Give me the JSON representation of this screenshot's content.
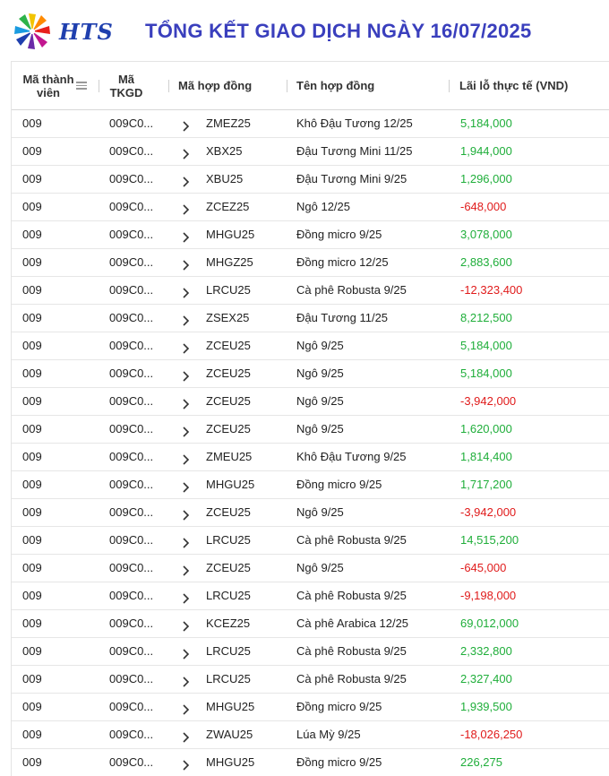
{
  "header": {
    "logo_text": "HTS",
    "title": "TỔNG KẾT GIAO DỊCH NGÀY 16/07/2025"
  },
  "columns": {
    "member_line1": "Mã thành",
    "member_line2": "viên",
    "account_line1": "Mã",
    "account_line2": "TKGD",
    "contract_code": "Mã hợp đồng",
    "contract_name": "Tên hợp đồng",
    "pnl": "Lãi lỗ thực tế (VND)"
  },
  "colors": {
    "positive": "#1fae3a",
    "negative": "#e01b1b",
    "title": "#3a3fbd"
  },
  "rows": [
    {
      "member": "009",
      "account": "009C0...",
      "code": "ZMEZ25",
      "name": "Khô Đậu Tương 12/25",
      "pnl": "5,184,000",
      "sign": "pos"
    },
    {
      "member": "009",
      "account": "009C0...",
      "code": "XBX25",
      "name": "Đậu Tương Mini 11/25",
      "pnl": "1,944,000",
      "sign": "pos"
    },
    {
      "member": "009",
      "account": "009C0...",
      "code": "XBU25",
      "name": "Đậu Tương Mini 9/25",
      "pnl": "1,296,000",
      "sign": "pos"
    },
    {
      "member": "009",
      "account": "009C0...",
      "code": "ZCEZ25",
      "name": "Ngô 12/25",
      "pnl": "-648,000",
      "sign": "neg"
    },
    {
      "member": "009",
      "account": "009C0...",
      "code": "MHGU25",
      "name": "Đồng micro 9/25",
      "pnl": "3,078,000",
      "sign": "pos"
    },
    {
      "member": "009",
      "account": "009C0...",
      "code": "MHGZ25",
      "name": "Đồng micro 12/25",
      "pnl": "2,883,600",
      "sign": "pos"
    },
    {
      "member": "009",
      "account": "009C0...",
      "code": "LRCU25",
      "name": "Cà phê Robusta 9/25",
      "pnl": "-12,323,400",
      "sign": "neg"
    },
    {
      "member": "009",
      "account": "009C0...",
      "code": "ZSEX25",
      "name": "Đậu Tương 11/25",
      "pnl": "8,212,500",
      "sign": "pos"
    },
    {
      "member": "009",
      "account": "009C0...",
      "code": "ZCEU25",
      "name": "Ngô 9/25",
      "pnl": "5,184,000",
      "sign": "pos"
    },
    {
      "member": "009",
      "account": "009C0...",
      "code": "ZCEU25",
      "name": "Ngô 9/25",
      "pnl": "5,184,000",
      "sign": "pos"
    },
    {
      "member": "009",
      "account": "009C0...",
      "code": "ZCEU25",
      "name": "Ngô 9/25",
      "pnl": "-3,942,000",
      "sign": "neg"
    },
    {
      "member": "009",
      "account": "009C0...",
      "code": "ZCEU25",
      "name": "Ngô 9/25",
      "pnl": "1,620,000",
      "sign": "pos"
    },
    {
      "member": "009",
      "account": "009C0...",
      "code": "ZMEU25",
      "name": "Khô Đậu Tương 9/25",
      "pnl": "1,814,400",
      "sign": "pos"
    },
    {
      "member": "009",
      "account": "009C0...",
      "code": "MHGU25",
      "name": "Đồng micro 9/25",
      "pnl": "1,717,200",
      "sign": "pos"
    },
    {
      "member": "009",
      "account": "009C0...",
      "code": "ZCEU25",
      "name": "Ngô 9/25",
      "pnl": "-3,942,000",
      "sign": "neg"
    },
    {
      "member": "009",
      "account": "009C0...",
      "code": "LRCU25",
      "name": "Cà phê Robusta 9/25",
      "pnl": "14,515,200",
      "sign": "pos"
    },
    {
      "member": "009",
      "account": "009C0...",
      "code": "ZCEU25",
      "name": "Ngô 9/25",
      "pnl": "-645,000",
      "sign": "neg"
    },
    {
      "member": "009",
      "account": "009C0...",
      "code": "LRCU25",
      "name": "Cà phê Robusta 9/25",
      "pnl": "-9,198,000",
      "sign": "neg"
    },
    {
      "member": "009",
      "account": "009C0...",
      "code": "KCEZ25",
      "name": "Cà phê Arabica 12/25",
      "pnl": "69,012,000",
      "sign": "pos"
    },
    {
      "member": "009",
      "account": "009C0...",
      "code": "LRCU25",
      "name": "Cà phê Robusta 9/25",
      "pnl": "2,332,800",
      "sign": "pos"
    },
    {
      "member": "009",
      "account": "009C0...",
      "code": "LRCU25",
      "name": "Cà phê Robusta 9/25",
      "pnl": "2,327,400",
      "sign": "pos"
    },
    {
      "member": "009",
      "account": "009C0...",
      "code": "MHGU25",
      "name": "Đồng micro 9/25",
      "pnl": "1,939,500",
      "sign": "pos"
    },
    {
      "member": "009",
      "account": "009C0...",
      "code": "ZWAU25",
      "name": "Lúa Mỳ 9/25",
      "pnl": "-18,026,250",
      "sign": "neg"
    },
    {
      "member": "009",
      "account": "009C0...",
      "code": "MHGU25",
      "name": "Đồng micro 9/25",
      "pnl": "226,275",
      "sign": "pos"
    }
  ]
}
